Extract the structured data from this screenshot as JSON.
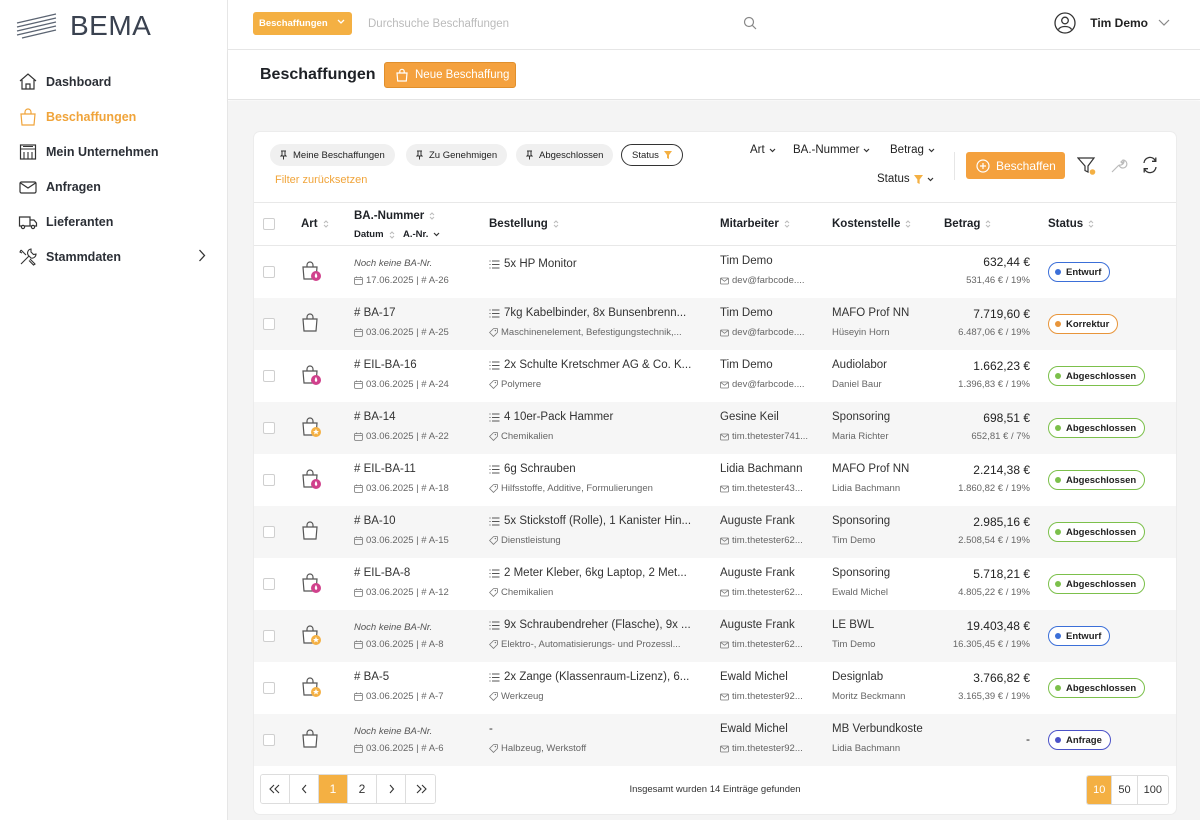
{
  "app": {
    "name": "BEMA"
  },
  "sidebar": {
    "items": [
      {
        "label": "Dashboard",
        "icon": "home-icon"
      },
      {
        "label": "Beschaffungen",
        "icon": "shopping-bag-icon",
        "active": true
      },
      {
        "label": "Mein Unternehmen",
        "icon": "building-icon"
      },
      {
        "label": "Anfragen",
        "icon": "envelope-icon"
      },
      {
        "label": "Lieferanten",
        "icon": "truck-icon"
      },
      {
        "label": "Stammdaten",
        "icon": "tools-icon",
        "has_submenu": true
      }
    ]
  },
  "topbar": {
    "category_label": "Beschaffungen",
    "search_placeholder": "Durchsuche Beschaffungen",
    "user_name": "Tim Demo"
  },
  "page": {
    "title": "Beschaffungen",
    "new_button": "Neue Beschaffung"
  },
  "filters": {
    "chips": [
      "Meine Beschaffungen",
      "Zu Genehmigen",
      "Abgeschlossen"
    ],
    "status_chip": "Status",
    "reset": "Filter zurücksetzen",
    "sort": {
      "art": "Art",
      "ba_nummer": "BA.-Nummer",
      "betrag": "Betrag",
      "status": "Status"
    },
    "beschaffen_button": "Beschaffen"
  },
  "table": {
    "headers": {
      "art": "Art",
      "ba_nummer": "BA.-Nummer",
      "datum": "Datum",
      "a_nr": "A.-Nr.",
      "bestellung": "Bestellung",
      "mitarbeiter": "Mitarbeiter",
      "kostenstelle": "Kostenstelle",
      "betrag": "Betrag",
      "status": "Status"
    },
    "rows": [
      {
        "ba": "Noch keine BA-Nr.",
        "ba_italic": true,
        "datum": "17.06.2025 | # A-26",
        "art_badge": "pink",
        "bestellung": "5x HP Monitor",
        "kategorie": "",
        "mitarbeiter": "Tim Demo",
        "email": "dev@farbcode....",
        "kostenstelle": "",
        "kst_person": "",
        "betrag": "632,44 €",
        "netto": "531,46 € / 19%",
        "status": "Entwurf",
        "status_color": "blue"
      },
      {
        "ba": "# BA-17",
        "ba_italic": false,
        "datum": "03.06.2025 | # A-25",
        "art_badge": "",
        "bestellung": "7kg Kabelbinder, 8x Bunsenbrenn...",
        "kategorie": "Maschinenelement, Befestigungstechnik,...",
        "mitarbeiter": "Tim Demo",
        "email": "dev@farbcode....",
        "kostenstelle": "MAFO Prof NN",
        "kst_person": "Hüseyin Horn",
        "betrag": "7.719,60 €",
        "netto": "6.487,06 € / 19%",
        "status": "Korrektur",
        "status_color": "orange"
      },
      {
        "ba": "# EIL-BA-16",
        "ba_italic": false,
        "datum": "03.06.2025 | # A-24",
        "art_badge": "pink",
        "bestellung": "2x Schulte Kretschmer AG & Co. K...",
        "kategorie": "Polymere",
        "mitarbeiter": "Tim Demo",
        "email": "dev@farbcode....",
        "kostenstelle": "Audiolabor",
        "kst_person": "Daniel Baur",
        "betrag": "1.662,23 €",
        "netto": "1.396,83 € / 19%",
        "status": "Abgeschlossen",
        "status_color": "green"
      },
      {
        "ba": "# BA-14",
        "ba_italic": false,
        "datum": "03.06.2025 | # A-22",
        "art_badge": "star",
        "bestellung": "4 10er-Pack Hammer",
        "kategorie": "Chemikalien",
        "mitarbeiter": "Gesine Keil",
        "email": "tim.thetester741...",
        "kostenstelle": "Sponsoring",
        "kst_person": "Maria Richter",
        "betrag": "698,51 €",
        "netto": "652,81 € / 7%",
        "status": "Abgeschlossen",
        "status_color": "green"
      },
      {
        "ba": "# EIL-BA-11",
        "ba_italic": false,
        "datum": "03.06.2025 | # A-18",
        "art_badge": "pink",
        "bestellung": "6g Schrauben",
        "kategorie": "Hilfsstoffe, Additive, Formulierungen",
        "mitarbeiter": "Lidia Bachmann",
        "email": "tim.thetester43...",
        "kostenstelle": "MAFO Prof NN",
        "kst_person": "Lidia Bachmann",
        "betrag": "2.214,38 €",
        "netto": "1.860,82 € / 19%",
        "status": "Abgeschlossen",
        "status_color": "green"
      },
      {
        "ba": "# BA-10",
        "ba_italic": false,
        "datum": "03.06.2025 | # A-15",
        "art_badge": "",
        "bestellung": "5x Stickstoff (Rolle), 1 Kanister Hin...",
        "kategorie": "Dienstleistung",
        "mitarbeiter": "Auguste Frank",
        "email": "tim.thetester62...",
        "kostenstelle": "Sponsoring",
        "kst_person": "Tim Demo",
        "betrag": "2.985,16 €",
        "netto": "2.508,54 € / 19%",
        "status": "Abgeschlossen",
        "status_color": "green"
      },
      {
        "ba": "# EIL-BA-8",
        "ba_italic": false,
        "datum": "03.06.2025 | # A-12",
        "art_badge": "pink",
        "bestellung": "2 Meter Kleber, 6kg Laptop, 2 Met...",
        "kategorie": "Chemikalien",
        "mitarbeiter": "Auguste Frank",
        "email": "tim.thetester62...",
        "kostenstelle": "Sponsoring",
        "kst_person": "Ewald Michel",
        "betrag": "5.718,21 €",
        "netto": "4.805,22 € / 19%",
        "status": "Abgeschlossen",
        "status_color": "green"
      },
      {
        "ba": "Noch keine BA-Nr.",
        "ba_italic": true,
        "datum": "03.06.2025 | # A-8",
        "art_badge": "star",
        "bestellung": "9x Schraubendreher (Flasche), 9x ...",
        "kategorie": "Elektro-, Automatisierungs- und Prozessl...",
        "mitarbeiter": "Auguste Frank",
        "email": "tim.thetester62...",
        "kostenstelle": "LE BWL",
        "kst_person": "Tim Demo",
        "betrag": "19.403,48 €",
        "netto": "16.305,45 € / 19%",
        "status": "Entwurf",
        "status_color": "blue"
      },
      {
        "ba": "# BA-5",
        "ba_italic": false,
        "datum": "03.06.2025 | # A-7",
        "art_badge": "star",
        "bestellung": "2x Zange (Klassenraum-Lizenz), 6...",
        "kategorie": "Werkzeug",
        "mitarbeiter": "Ewald Michel",
        "email": "tim.thetester92...",
        "kostenstelle": "Designlab",
        "kst_person": "Moritz Beckmann",
        "betrag": "3.766,82 €",
        "netto": "3.165,39 € / 19%",
        "status": "Abgeschlossen",
        "status_color": "green"
      },
      {
        "ba": "Noch keine BA-Nr.",
        "ba_italic": true,
        "datum": "03.06.2025 | # A-6",
        "art_badge": "",
        "bestellung": "-",
        "kategorie": "Halbzeug, Werkstoff",
        "mitarbeiter": "Ewald Michel",
        "email": "tim.thetester92...",
        "kostenstelle": "MB Verbundkoste",
        "kst_person": "Lidia Bachmann",
        "betrag": "-",
        "netto": "",
        "status": "Anfrage",
        "status_color": "indigo"
      }
    ]
  },
  "pagination": {
    "pages": [
      "1",
      "2"
    ],
    "current": "1",
    "total_text": "Insgesamt wurden 14 Einträge gefunden",
    "sizes": [
      "10",
      "50",
      "100"
    ],
    "current_size": "10"
  },
  "colors": {
    "accent": "#f4a13e",
    "blue": "#3b6fd8",
    "green": "#7cc04b",
    "orange": "#e8953a",
    "indigo": "#4b52c8",
    "pink": "#d0418c"
  }
}
